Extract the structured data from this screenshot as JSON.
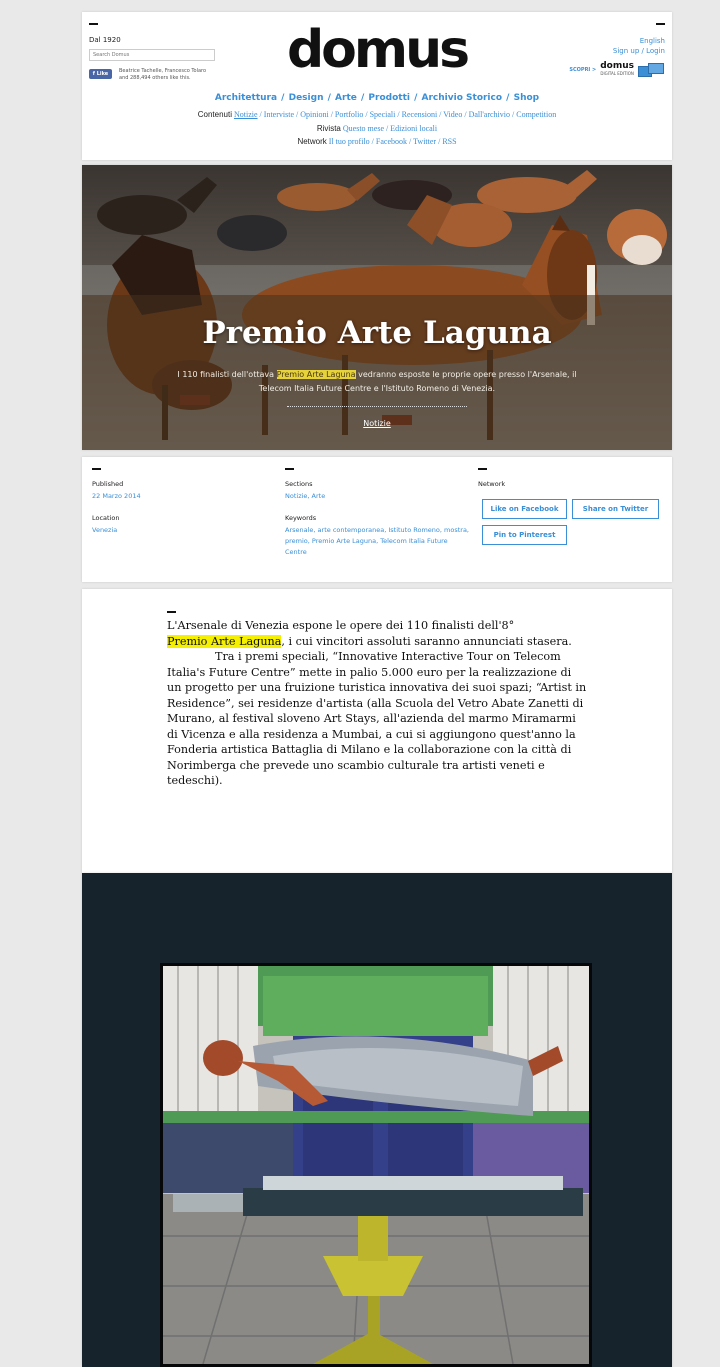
{
  "header": {
    "since": "Dal 1920",
    "search_placeholder": "Search Domus",
    "fb_like_label": "Like",
    "fb_text": "Beatrice Tachelle, Francesco Tolaro and 288,494 others like this.",
    "logo": "domus",
    "lang": "English",
    "signup": "Sign up",
    "login": "Login",
    "scope_label": "SCOPRI >",
    "scope_brand": "domus",
    "scope_sub": "DIGITAL EDITION",
    "main_nav": [
      "Architettura",
      "Design",
      "Arte",
      "Prodotti",
      "Archivio Storico",
      "Shop"
    ],
    "contenuti_label": "Contenuti",
    "contenuti_links": [
      "Notizie",
      "Interviste",
      "Opinioni",
      "Portfolio",
      "Speciali",
      "Recensioni",
      "Video",
      "Dall'archivio",
      "Competition"
    ],
    "rivista_label": "Rivista",
    "rivista_links": [
      "Questo mese",
      "Edizioni locali"
    ],
    "network_label": "Network",
    "network_links": [
      "Il tuo profilo",
      "Facebook",
      "Twitter",
      "RSS"
    ]
  },
  "hero": {
    "title": "Premio Arte Laguna",
    "sub_before": "I 110 finalisti dell'ottava ",
    "sub_highlight": "Premio Arte Laguna",
    "sub_after": " vedranno esposte le proprie opere presso l'Arsenale, il Telecom Italia Future Centre e l'Istituto Romeno di Venezia.",
    "category": "Notizie"
  },
  "meta": {
    "published_label": "Published",
    "published_value": "22 Marzo 2014",
    "location_label": "Location",
    "location_value": "Venezia",
    "sections_label": "Sections",
    "sections_value": "Notizie, Arte",
    "keywords_label": "Keywords",
    "keywords_value": "Arsenale, arte contemporanea, Istituto Romeno, mostra, premio, Premio Arte Laguna, Telecom Italia Future Centre",
    "network_label": "Network",
    "btn_facebook": "Like on Facebook",
    "btn_twitter": "Share on Twitter",
    "btn_pinterest": "Pin to Pinterest"
  },
  "article": {
    "p1_before": "L'Arsenale di Venezia espone le opere dei 110 finalisti dell'8°",
    "p1_highlight": "Premio Arte Laguna",
    "p1_after": ", i cui vincitori assoluti saranno annunciati stasera.",
    "p2": "Tra i premi speciali, “Innovative Interactive Tour on Telecom Italia's Future Centre” mette in palio 5.000 euro per la realizzazione di un progetto per una fruizione turistica innovativa dei suoi spazi; “Artist in Residence”, sei residenze d'artista (alla Scuola del Vetro Abate Zanetti di Murano, al festival sloveno Art Stays, all'azienda del marmo Miramarmi di Vicenza e alla residenza a Mumbai, a cui si aggiungono quest'anno la Fonderia artistica Battaglia di Milano e la collaborazione con la città di Norimberga che prevede uno scambio culturale tra artisti veneti e tedeschi)."
  }
}
